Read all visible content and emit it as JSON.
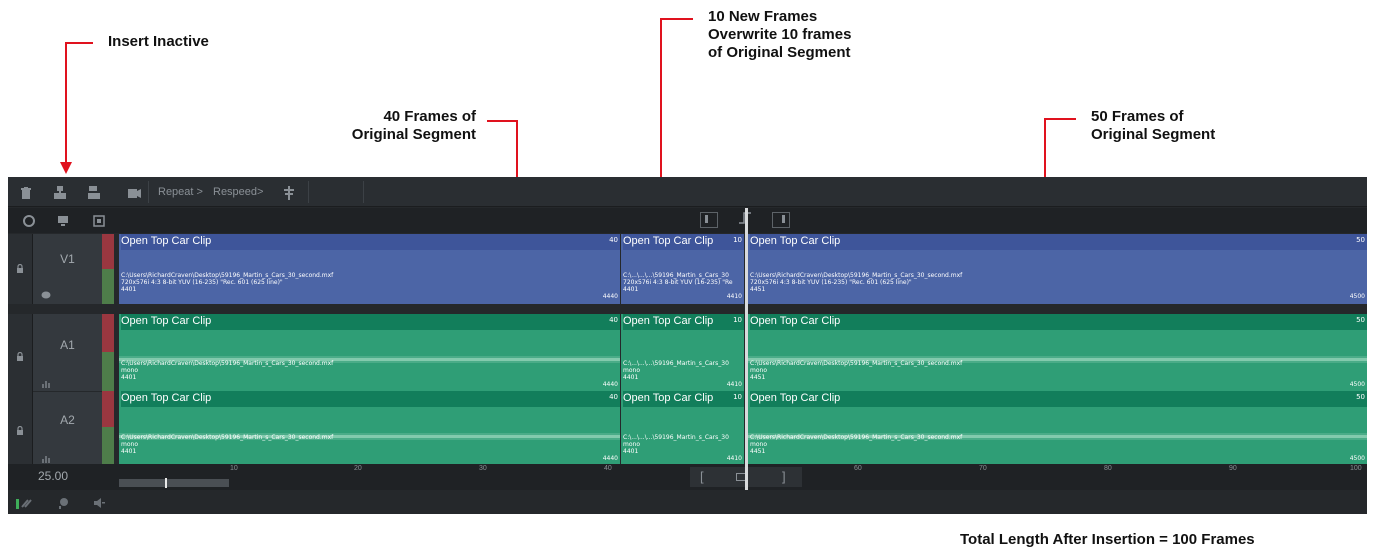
{
  "annotations": {
    "insert_inactive": "Insert Inactive",
    "new_frames_line1": "10 New Frames",
    "new_frames_line2": "Overwrite 10 frames",
    "new_frames_line3": "of Original Segment",
    "frames40_line1": "40 Frames of",
    "frames40_line2": "Original Segment",
    "frames50_line1": "50 Frames of",
    "frames50_line2": "Original Segment",
    "total": "Total Length After Insertion = 100 Frames",
    "arrow_color": "#e0121e"
  },
  "toolbar": {
    "icons": [
      "trash-icon",
      "insert-icon",
      "overwrite-icon",
      "clip-icon"
    ],
    "repeat_label": "Repeat >",
    "respeed_label": "Respeed>",
    "extra_icon": "align-icon"
  },
  "subbar": {
    "icons": [
      "comment-toggle-icon",
      "monitor-icon",
      "snapshot-icon"
    ],
    "mid_buttons": [
      "trim-left-icon",
      "trim-both-icon",
      "trim-right-icon"
    ]
  },
  "tracks": [
    {
      "name": "V1",
      "type": "video"
    },
    {
      "name": "A1",
      "type": "audio"
    },
    {
      "name": "A2",
      "type": "audio"
    }
  ],
  "clips": {
    "seg1": {
      "title": "Open Top Car Clip",
      "end_count": "40",
      "path": "C:\\Users\\RichardCraven\\Desktop\\59196_Martin_s_Cars_30_second.mxf",
      "video_info": "720x576i 4:3 8-bit YUV (16-235) \"Rec. 601 (625 line)\"",
      "audio_info": "mono",
      "start_tc": "4401",
      "end_tc": "4440"
    },
    "seg2": {
      "title": "Open Top Car Clip",
      "end_count": "10",
      "path": "C:\\...\\...\\...\\59196_Martin_s_Cars_30",
      "video_info": "720x576i 4:3 8-bit YUV (16-235) \"Re",
      "audio_info": "mono",
      "start_tc": "4401",
      "end_tc": "4410"
    },
    "seg3": {
      "title": "Open Top Car Clip",
      "end_count": "50",
      "path": "C:\\Users\\RichardCraven\\Desktop\\59196_Martin_s_Cars_30_second.mxf",
      "video_info": "720x576i 4:3 8-bit YUV (16-235) \"Rec. 601 (625 line)\"",
      "audio_info": "mono",
      "start_tc": "4451",
      "end_tc": "4500"
    }
  },
  "ruler": {
    "fps": "25.00",
    "ticks": [
      "10",
      "20",
      "30",
      "40",
      "60",
      "70",
      "80",
      "90",
      "100"
    ],
    "mid_buttons": [
      "mark-in-icon",
      "mark-clip-icon",
      "mark-out-icon"
    ]
  },
  "bottom": {
    "icons": [
      "level-meter-icon",
      "marker-icon",
      "audio-icon"
    ]
  }
}
